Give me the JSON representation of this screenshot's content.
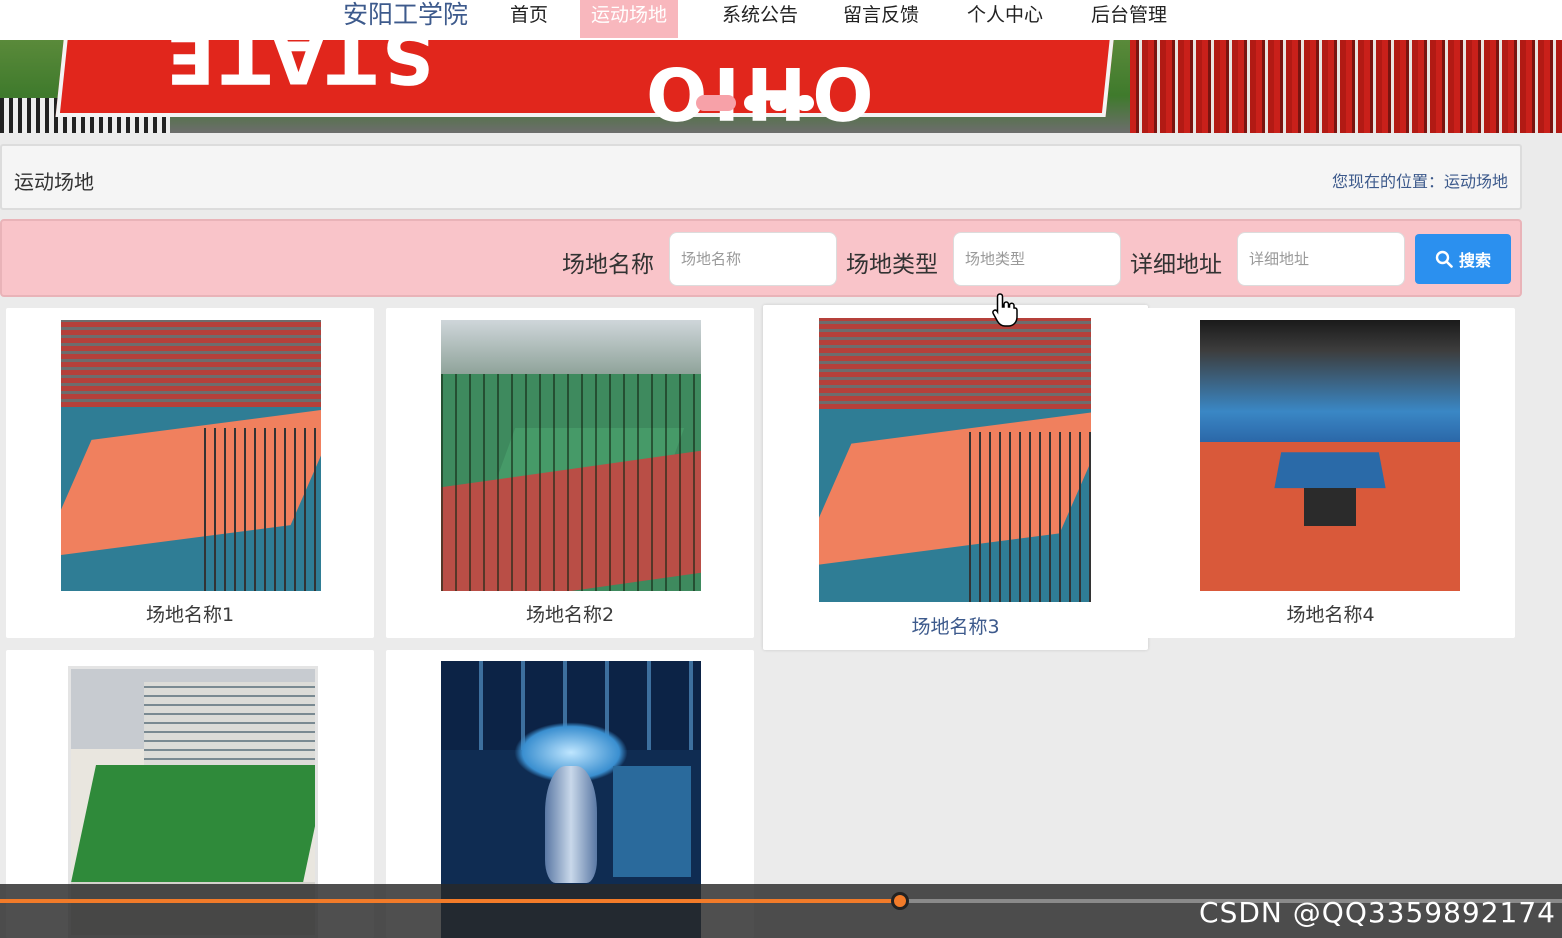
{
  "nav": {
    "brand": "安阳工学院",
    "items": [
      {
        "label": "首页",
        "active": false
      },
      {
        "label": "运动场地",
        "active": true
      },
      {
        "label": "系统公告",
        "active": false
      },
      {
        "label": "留言反馈",
        "active": false
      },
      {
        "label": "个人中心",
        "active": false
      },
      {
        "label": "后台管理",
        "active": false
      }
    ]
  },
  "banner": {
    "text_ohio": "OHIO",
    "text_state": "STATE",
    "slides": 4,
    "active_slide": 1
  },
  "breadcrumb": {
    "title": "运动场地",
    "location": "您现在的位置：运动场地"
  },
  "search": {
    "fields": [
      {
        "label": "场地名称",
        "placeholder": "场地名称"
      },
      {
        "label": "场地类型",
        "placeholder": "场地类型"
      },
      {
        "label": "详细地址",
        "placeholder": "详细地址"
      }
    ],
    "button_label": "搜索"
  },
  "cards": [
    {
      "name": "场地名称1",
      "image": "volleyball-court-icon"
    },
    {
      "name": "场地名称2",
      "image": "basketball-court-icon"
    },
    {
      "name": "场地名称3",
      "image": "volleyball-court-icon"
    },
    {
      "name": "场地名称4",
      "image": "table-tennis-hall-icon"
    },
    {
      "name": "",
      "image": "football-field-icon"
    },
    {
      "name": "",
      "image": "exhibition-hall-icon"
    }
  ],
  "player": {
    "progress": 0.576,
    "watermark": "CSDN @QQ3359892174"
  },
  "colors": {
    "accent_pink": "#f8b7bd",
    "search_bg": "#f9c4c9",
    "button_blue": "#2b90ef",
    "link_blue": "#3d5a8c",
    "progress_orange": "#f27b29"
  }
}
